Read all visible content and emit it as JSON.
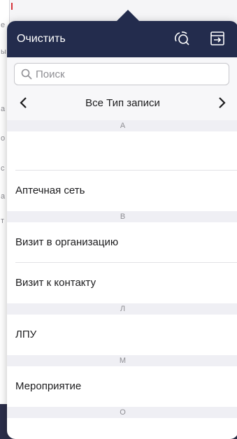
{
  "header": {
    "clear_label": "Очистить",
    "icons": [
      "search-settings-icon",
      "export-icon"
    ]
  },
  "search": {
    "placeholder": "Поиск",
    "value": ""
  },
  "nav": {
    "title": "Все Тип записи"
  },
  "sections": [
    {
      "letter": "А",
      "items": [
        "",
        "Аптечная сеть"
      ]
    },
    {
      "letter": "В",
      "items": [
        "Визит в организацию",
        "Визит к контакту"
      ]
    },
    {
      "letter": "Л",
      "items": [
        "ЛПУ"
      ]
    },
    {
      "letter": "М",
      "items": [
        "Мероприятие"
      ]
    },
    {
      "letter": "О",
      "items": []
    }
  ],
  "background": {
    "side_letters": [
      "е",
      "ы",
      "а",
      "о",
      "с",
      "а",
      "т"
    ],
    "accent_color": "#232c4d",
    "marker_color": "#d6343c"
  }
}
